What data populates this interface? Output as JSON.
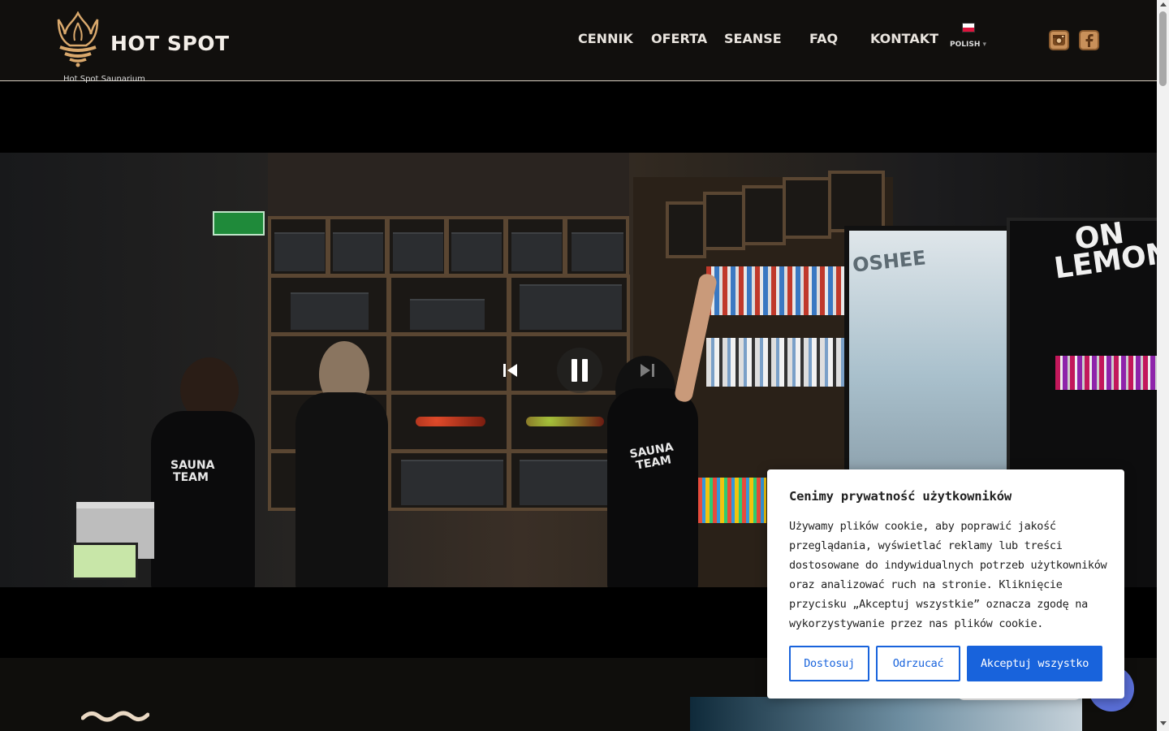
{
  "header": {
    "brand": "HOT SPOT",
    "nav": [
      {
        "label": "CENNIK"
      },
      {
        "label": "OFERTA"
      },
      {
        "label": "SEANSE"
      },
      {
        "label": "FAQ"
      },
      {
        "label": "KONTAKT"
      }
    ],
    "language": {
      "label": "POLISH",
      "caret": "▾"
    },
    "social": [
      {
        "icon": "instagram-icon"
      },
      {
        "icon": "facebook-icon"
      }
    ]
  },
  "breadcrumb": "Hot Spot Saunarium",
  "video": {
    "controls": {
      "prev_icon": "skip-previous-icon",
      "pause_icon": "pause-icon",
      "next_icon": "skip-next-icon"
    },
    "scene_text": {
      "sign_1": "OSHEE",
      "sign_2a": "ON",
      "sign_2b": "LEMON",
      "tee_1a": "SAUNA",
      "tee_1b": "TEAM",
      "tee_2a": "SAUNA",
      "tee_2b": "TEAM"
    }
  },
  "cookie_banner": {
    "title": "Cenimy prywatność użytkowników",
    "body": "Używamy plików cookie, aby poprawić jakość przeglądania, wyświetlać reklamy lub treści dostosowane do indywidualnych potrzeb użytkowników oraz analizować ruch na stronie. Kliknięcie przycisku „Akceptuj wszystkie” oznacza zgodę na wykorzystywanie przez nas plików cookie.",
    "buttons": {
      "customize": "Dostosuj",
      "reject": "Odrzucać",
      "accept": "Akceptuj wszystko"
    }
  },
  "colors": {
    "accent": "#1863dc",
    "brand_gold": "#c8905a",
    "header_bg": "#110f0d"
  }
}
